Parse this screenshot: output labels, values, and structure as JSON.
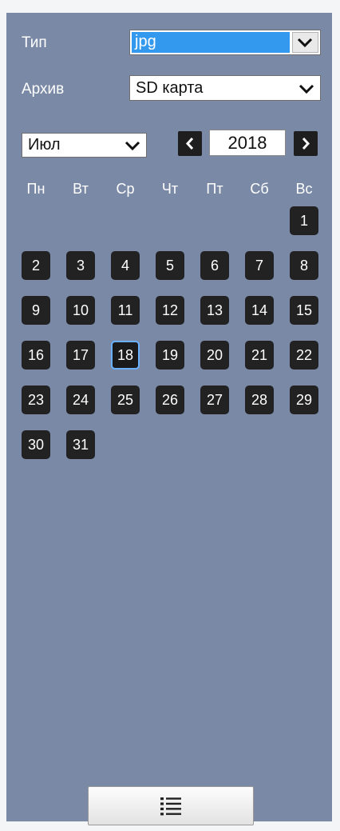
{
  "filters": {
    "type_label": "Тип",
    "type_value": "jpg",
    "archive_label": "Архив",
    "archive_value": "SD карта"
  },
  "calendar": {
    "month": "Июл",
    "year": "2018",
    "weekdays": [
      "Пн",
      "Вт",
      "Ср",
      "Чт",
      "Пт",
      "Сб",
      "Вс"
    ],
    "first_weekday_index": 6,
    "days_in_month": 31,
    "selected_day": 18
  },
  "icons": {
    "prev": "chevron-left-icon",
    "next": "chevron-right-icon",
    "dropdown": "chevron-down-icon",
    "list": "list-icon"
  },
  "colors": {
    "panel": "#7a8aa6",
    "day_bg": "#222222",
    "selected_border": "#6ab0ff",
    "selection_highlight": "#3399ee"
  }
}
